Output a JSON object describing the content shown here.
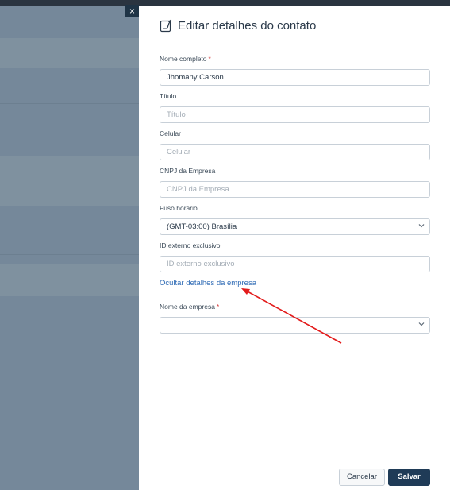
{
  "dialog": {
    "title": "Editar detalhes do contato",
    "close_glyph": "×"
  },
  "fields": {
    "full_name": {
      "label": "Nome completo",
      "required_mark": "*",
      "value": "Jhomany Carson"
    },
    "title": {
      "label": "Título",
      "placeholder": "Título"
    },
    "mobile": {
      "label": "Celular",
      "placeholder": "Celular"
    },
    "cnpj": {
      "label": "CNPJ da Empresa",
      "placeholder": "CNPJ da Empresa"
    },
    "timezone": {
      "label": "Fuso horário",
      "value": "(GMT-03:00) Brasília"
    },
    "external_id": {
      "label": "ID externo exclusivo",
      "placeholder": "ID externo exclusivo"
    },
    "company_name": {
      "label": "Nome da empresa",
      "required_mark": "*",
      "value": ""
    }
  },
  "toggle_company_link": "Ocultar detalhes da empresa",
  "footer": {
    "cancel_label": "Cancelar",
    "save_label": "Salvar"
  },
  "colors": {
    "accent_link": "#2f6bb5",
    "primary_button": "#1f3b57",
    "required": "#d33a3a",
    "annotation_arrow": "#e31b1b"
  },
  "icons": {
    "header": "contact-edit-icon",
    "close": "close-icon",
    "dropdown": "chevron-down-icon"
  }
}
